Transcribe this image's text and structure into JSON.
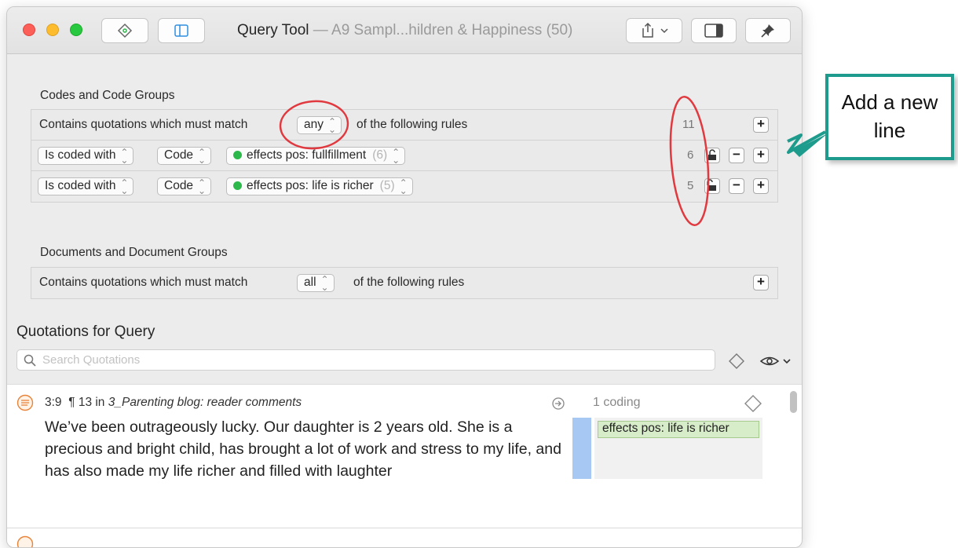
{
  "window": {
    "title": "Query Tool",
    "subtitle": " — A9 Sampl...hildren & Happiness (50)"
  },
  "codes_section": {
    "label": "Codes and Code Groups",
    "header_prefix": "Contains quotations which must match",
    "match_value": "any",
    "header_suffix": "of the following rules",
    "header_count": "11",
    "rules": [
      {
        "operator": "Is coded with",
        "type": "Code",
        "code": "effects pos: fullfillment",
        "code_count": "(6)",
        "count": "6"
      },
      {
        "operator": "Is coded with",
        "type": "Code",
        "code": "effects pos: life is richer",
        "code_count": "(5)",
        "count": "5"
      }
    ]
  },
  "documents_section": {
    "label": "Documents and Document Groups",
    "header_prefix": "Contains quotations which must match",
    "match_value": "all",
    "header_suffix": "of the following rules"
  },
  "quotations": {
    "title": "Quotations for Query",
    "search_placeholder": "Search Quotations",
    "items": [
      {
        "id": "3:9",
        "para": "¶ 13 in",
        "document": "3_Parenting blog: reader comments",
        "text": "We’ve been outrageously lucky. Our daughter is 2 years old. She is a precious and bright child, has brought a lot of work and stress to my life, and has also made my life richer and filled with laughter",
        "coding_count": "1 coding",
        "code": "effects pos: life is richer"
      }
    ]
  },
  "annotation": {
    "callout": "Add a new line"
  },
  "colors": {
    "code_dot": "#2db84b",
    "callout_border": "#1d9c8d",
    "highlight_circle": "#e0393f",
    "quotation_bar": "#a6c8f2"
  }
}
